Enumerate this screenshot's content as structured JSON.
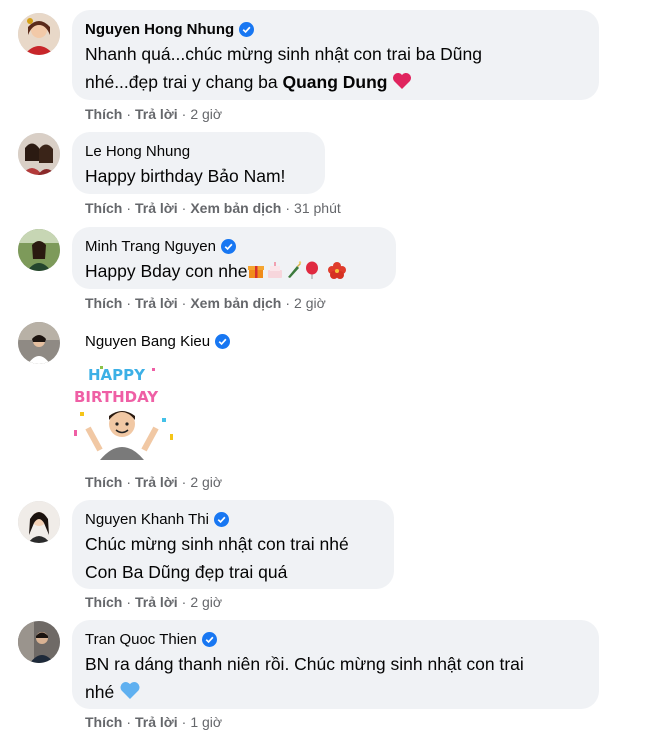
{
  "labels": {
    "like": "Thích",
    "reply": "Trả lời",
    "translate": "Xem bản dịch",
    "sep": "·"
  },
  "comments": [
    {
      "name": "Nguyen Hong Nhung",
      "verified": true,
      "line1": "Nhanh quá...chúc mừng sinh nhật con trai ba Dũng",
      "line2_pre": "nhé...đẹp trai y chang ba ",
      "line2_bold": "Quang Dung",
      "time": "2 giờ"
    },
    {
      "name": "Le Hong Nhung",
      "verified": false,
      "line1": "Happy birthday Bảo Nam!",
      "time": "31 phút"
    },
    {
      "name": "Minh Trang Nguyen",
      "verified": true,
      "line1": "Happy Bday con nhe",
      "time": "2 giờ"
    },
    {
      "name": "Nguyen Bang Kieu",
      "verified": true,
      "sticker_text": "HAPPY BIRTHDAY",
      "time": "2 giờ"
    },
    {
      "name": "Nguyen Khanh Thi",
      "verified": true,
      "line1": "Chúc mừng sinh nhật con trai nhé",
      "line2": "Con Ba Dũng đẹp trai quá",
      "time": "2 giờ"
    },
    {
      "name": "Tran Quoc Thien",
      "verified": true,
      "line1": "BN ra dáng thanh niên rồi. Chúc mừng sinh nhật con trai",
      "line2": "nhé",
      "time": "1 giờ"
    }
  ],
  "colors": {
    "bubble": "#f0f2f5",
    "verified": "#1877f2",
    "meta": "#65676b"
  }
}
